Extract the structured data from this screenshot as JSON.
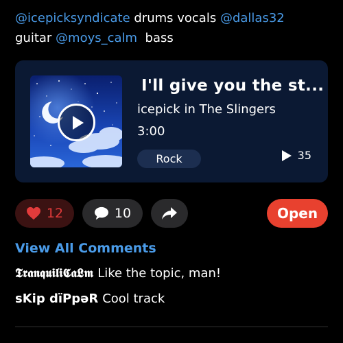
{
  "credits": {
    "handle1": "@icepicksyndicate",
    "role1": " drums vocals ",
    "handle2": "@dallas32",
    "role2_prefix": "guitar ",
    "handle3": "@moys_calm",
    "role3": "  bass"
  },
  "track": {
    "title": "I'll give you the st...",
    "artist": "icepick in The Slingers",
    "duration": "3:00",
    "genre": "Rock",
    "plays": "35",
    "play_icon": "play-icon"
  },
  "actions": {
    "likes": "12",
    "comments": "10",
    "open_label": "Open"
  },
  "comments_section": {
    "view_all": "View All Comments",
    "items": [
      {
        "user": "𝕿𝖗𝖆𝖓𝖖𝖚𝖎𝖑𝖎𝕮𝖆𝕷𝖒",
        "text": "Like the topic, man!"
      },
      {
        "user": "sKip dïPpəR",
        "text": "Cool track"
      }
    ]
  },
  "colors": {
    "accent_blue": "#4a9be8",
    "like_red": "#e23b3b",
    "open_button": "#e8412f",
    "card_bg": "#0b1933"
  }
}
